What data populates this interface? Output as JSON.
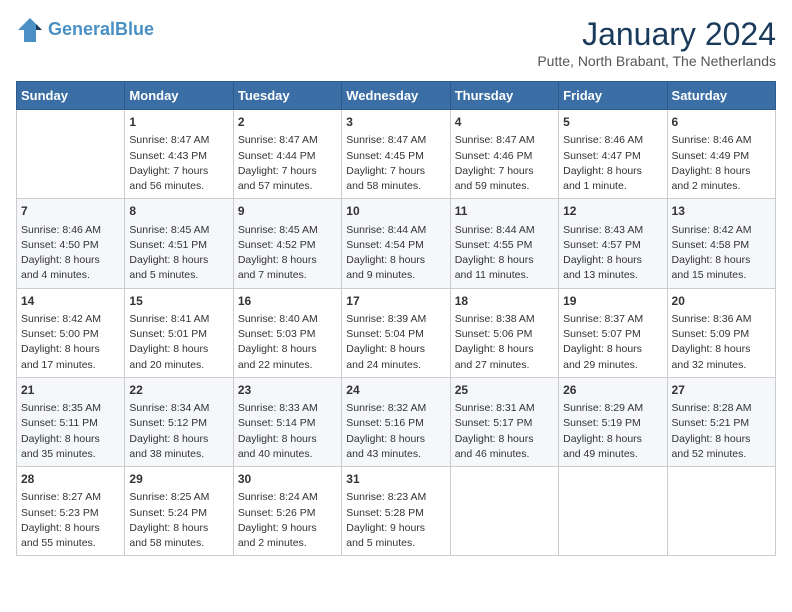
{
  "header": {
    "logo_line1": "General",
    "logo_line2": "Blue",
    "title": "January 2024",
    "subtitle": "Putte, North Brabant, The Netherlands"
  },
  "days_of_week": [
    "Sunday",
    "Monday",
    "Tuesday",
    "Wednesday",
    "Thursday",
    "Friday",
    "Saturday"
  ],
  "weeks": [
    [
      {
        "num": "",
        "content": ""
      },
      {
        "num": "1",
        "content": "Sunrise: 8:47 AM\nSunset: 4:43 PM\nDaylight: 7 hours\nand 56 minutes."
      },
      {
        "num": "2",
        "content": "Sunrise: 8:47 AM\nSunset: 4:44 PM\nDaylight: 7 hours\nand 57 minutes."
      },
      {
        "num": "3",
        "content": "Sunrise: 8:47 AM\nSunset: 4:45 PM\nDaylight: 7 hours\nand 58 minutes."
      },
      {
        "num": "4",
        "content": "Sunrise: 8:47 AM\nSunset: 4:46 PM\nDaylight: 7 hours\nand 59 minutes."
      },
      {
        "num": "5",
        "content": "Sunrise: 8:46 AM\nSunset: 4:47 PM\nDaylight: 8 hours\nand 1 minute."
      },
      {
        "num": "6",
        "content": "Sunrise: 8:46 AM\nSunset: 4:49 PM\nDaylight: 8 hours\nand 2 minutes."
      }
    ],
    [
      {
        "num": "7",
        "content": "Sunrise: 8:46 AM\nSunset: 4:50 PM\nDaylight: 8 hours\nand 4 minutes."
      },
      {
        "num": "8",
        "content": "Sunrise: 8:45 AM\nSunset: 4:51 PM\nDaylight: 8 hours\nand 5 minutes."
      },
      {
        "num": "9",
        "content": "Sunrise: 8:45 AM\nSunset: 4:52 PM\nDaylight: 8 hours\nand 7 minutes."
      },
      {
        "num": "10",
        "content": "Sunrise: 8:44 AM\nSunset: 4:54 PM\nDaylight: 8 hours\nand 9 minutes."
      },
      {
        "num": "11",
        "content": "Sunrise: 8:44 AM\nSunset: 4:55 PM\nDaylight: 8 hours\nand 11 minutes."
      },
      {
        "num": "12",
        "content": "Sunrise: 8:43 AM\nSunset: 4:57 PM\nDaylight: 8 hours\nand 13 minutes."
      },
      {
        "num": "13",
        "content": "Sunrise: 8:42 AM\nSunset: 4:58 PM\nDaylight: 8 hours\nand 15 minutes."
      }
    ],
    [
      {
        "num": "14",
        "content": "Sunrise: 8:42 AM\nSunset: 5:00 PM\nDaylight: 8 hours\nand 17 minutes."
      },
      {
        "num": "15",
        "content": "Sunrise: 8:41 AM\nSunset: 5:01 PM\nDaylight: 8 hours\nand 20 minutes."
      },
      {
        "num": "16",
        "content": "Sunrise: 8:40 AM\nSunset: 5:03 PM\nDaylight: 8 hours\nand 22 minutes."
      },
      {
        "num": "17",
        "content": "Sunrise: 8:39 AM\nSunset: 5:04 PM\nDaylight: 8 hours\nand 24 minutes."
      },
      {
        "num": "18",
        "content": "Sunrise: 8:38 AM\nSunset: 5:06 PM\nDaylight: 8 hours\nand 27 minutes."
      },
      {
        "num": "19",
        "content": "Sunrise: 8:37 AM\nSunset: 5:07 PM\nDaylight: 8 hours\nand 29 minutes."
      },
      {
        "num": "20",
        "content": "Sunrise: 8:36 AM\nSunset: 5:09 PM\nDaylight: 8 hours\nand 32 minutes."
      }
    ],
    [
      {
        "num": "21",
        "content": "Sunrise: 8:35 AM\nSunset: 5:11 PM\nDaylight: 8 hours\nand 35 minutes."
      },
      {
        "num": "22",
        "content": "Sunrise: 8:34 AM\nSunset: 5:12 PM\nDaylight: 8 hours\nand 38 minutes."
      },
      {
        "num": "23",
        "content": "Sunrise: 8:33 AM\nSunset: 5:14 PM\nDaylight: 8 hours\nand 40 minutes."
      },
      {
        "num": "24",
        "content": "Sunrise: 8:32 AM\nSunset: 5:16 PM\nDaylight: 8 hours\nand 43 minutes."
      },
      {
        "num": "25",
        "content": "Sunrise: 8:31 AM\nSunset: 5:17 PM\nDaylight: 8 hours\nand 46 minutes."
      },
      {
        "num": "26",
        "content": "Sunrise: 8:29 AM\nSunset: 5:19 PM\nDaylight: 8 hours\nand 49 minutes."
      },
      {
        "num": "27",
        "content": "Sunrise: 8:28 AM\nSunset: 5:21 PM\nDaylight: 8 hours\nand 52 minutes."
      }
    ],
    [
      {
        "num": "28",
        "content": "Sunrise: 8:27 AM\nSunset: 5:23 PM\nDaylight: 8 hours\nand 55 minutes."
      },
      {
        "num": "29",
        "content": "Sunrise: 8:25 AM\nSunset: 5:24 PM\nDaylight: 8 hours\nand 58 minutes."
      },
      {
        "num": "30",
        "content": "Sunrise: 8:24 AM\nSunset: 5:26 PM\nDaylight: 9 hours\nand 2 minutes."
      },
      {
        "num": "31",
        "content": "Sunrise: 8:23 AM\nSunset: 5:28 PM\nDaylight: 9 hours\nand 5 minutes."
      },
      {
        "num": "",
        "content": ""
      },
      {
        "num": "",
        "content": ""
      },
      {
        "num": "",
        "content": ""
      }
    ]
  ]
}
